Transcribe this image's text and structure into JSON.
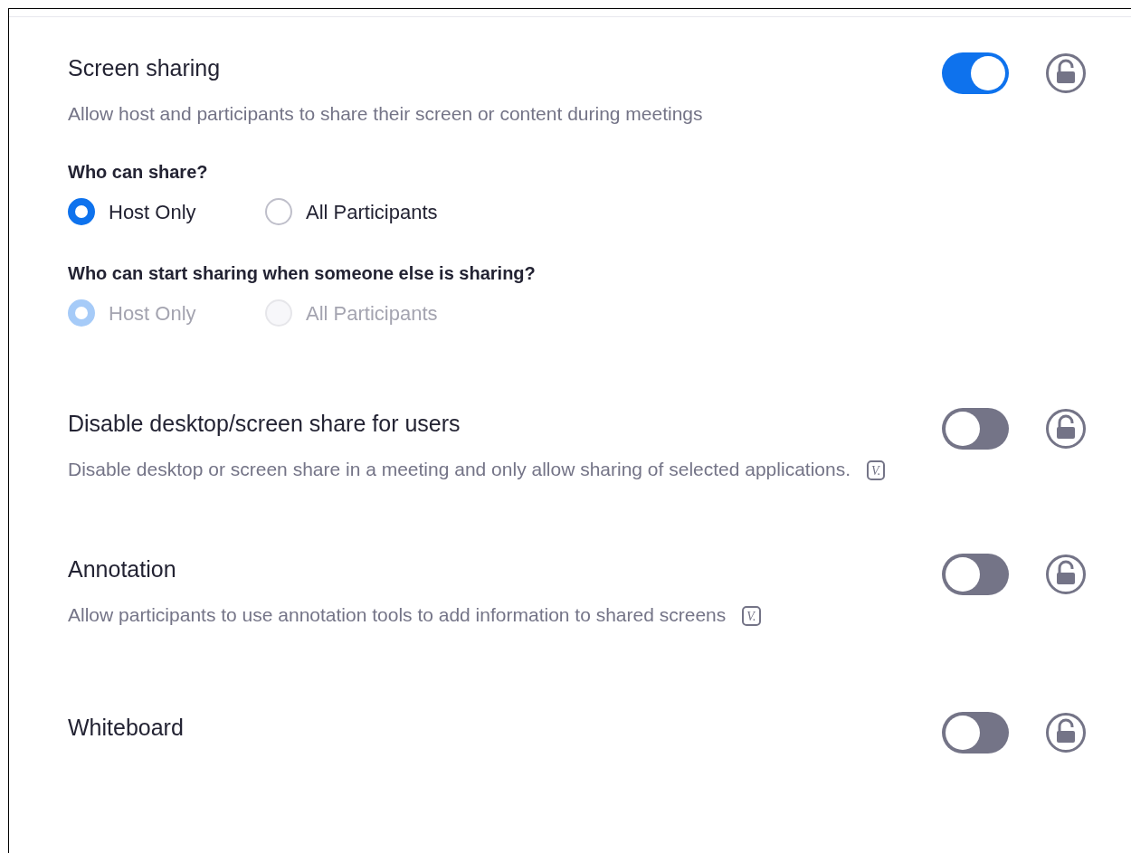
{
  "sections": [
    {
      "title": "Screen sharing",
      "description": "Allow host and participants to share their screen or content during meetings",
      "toggle": {
        "on": true
      },
      "locked": false,
      "groups": [
        {
          "question": "Who can share?",
          "disabled": false,
          "options": [
            {
              "label": "Host Only",
              "selected": true
            },
            {
              "label": "All Participants",
              "selected": false
            }
          ]
        },
        {
          "question": "Who can start sharing when someone else is sharing?",
          "disabled": true,
          "options": [
            {
              "label": "Host Only",
              "selected": true
            },
            {
              "label": "All Participants",
              "selected": false
            }
          ]
        }
      ]
    },
    {
      "title": "Disable desktop/screen share for users",
      "description": "Disable desktop or screen share in a meeting and only allow sharing of selected applications.",
      "badge": "V.",
      "toggle": {
        "on": false
      },
      "locked": false
    },
    {
      "title": "Annotation",
      "description": "Allow participants to use annotation tools to add information to shared screens",
      "badge": "V.",
      "toggle": {
        "on": false
      },
      "locked": false
    },
    {
      "title": "Whiteboard",
      "toggle": {
        "on": false
      },
      "locked": false
    }
  ]
}
